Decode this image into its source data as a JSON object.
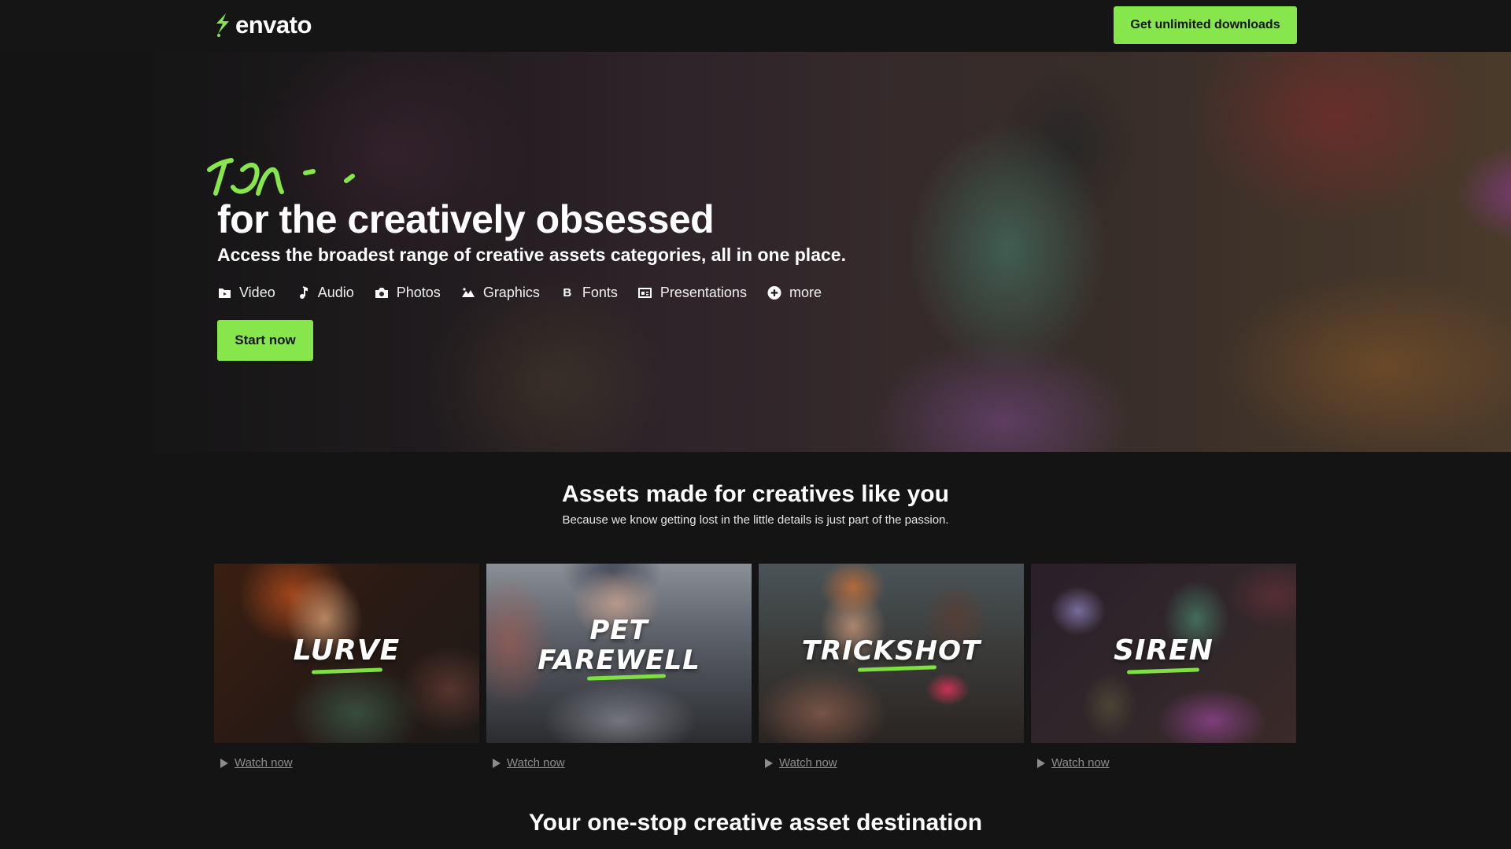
{
  "header": {
    "logo_text": "envato",
    "cta_label": "Get unlimited downloads"
  },
  "hero": {
    "title": "for the creatively obsessed",
    "subtitle": "Access the broadest range of creative assets categories, all in one place.",
    "categories": [
      {
        "label": "Video",
        "icon": "video-folder-icon"
      },
      {
        "label": "Audio",
        "icon": "music-note-icon"
      },
      {
        "label": "Photos",
        "icon": "camera-icon"
      },
      {
        "label": "Graphics",
        "icon": "mountain-image-icon"
      },
      {
        "label": "Fonts",
        "icon": "bold-b-icon"
      },
      {
        "label": "Presentations",
        "icon": "presentation-icon"
      },
      {
        "label": "more",
        "icon": "plus-circle-icon"
      }
    ],
    "start_label": "Start now"
  },
  "assets_section": {
    "title": "Assets made for creatives like you",
    "subtitle": "Because we know getting lost in the little details is just part of the passion."
  },
  "videos": [
    {
      "title_lines": [
        "LURVE"
      ],
      "watch_label": "Watch now"
    },
    {
      "title_lines": [
        "PET",
        "FAREWELL"
      ],
      "watch_label": "Watch now"
    },
    {
      "title_lines": [
        "TRICKSHOT"
      ],
      "watch_label": "Watch now"
    },
    {
      "title_lines": [
        "SIREN"
      ],
      "watch_label": "Watch now"
    }
  ],
  "bottom_section": {
    "title": "Your one-stop creative asset destination"
  },
  "colors": {
    "accent": "#87e64b",
    "background": "#141414",
    "muted_text": "#8c8c8c"
  }
}
